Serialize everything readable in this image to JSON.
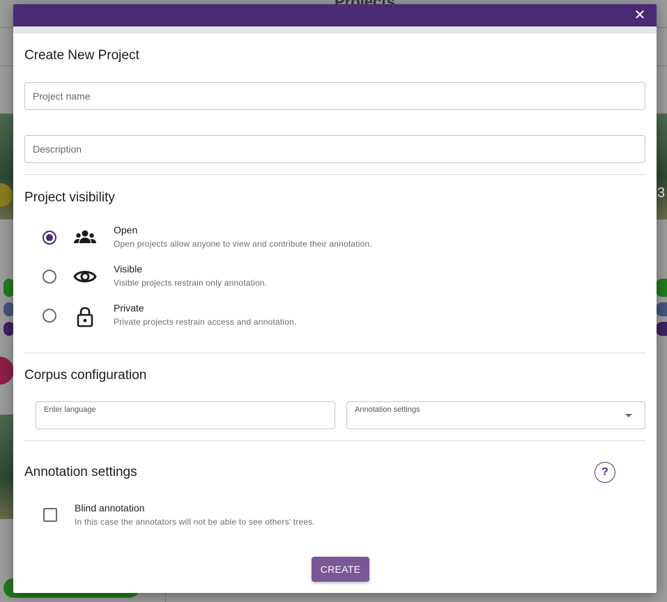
{
  "background": {
    "page_title": "Projects",
    "card_number": "3"
  },
  "dialog": {
    "close_icon": "close-icon",
    "title": "Create New Project",
    "project_name": {
      "value": "",
      "placeholder": "Project name"
    },
    "description": {
      "value": "",
      "placeholder": "Description"
    },
    "visibility": {
      "title": "Project visibility",
      "selected": "Open",
      "options": [
        {
          "label": "Open",
          "description": "Open projects allow anyone to view and contribute their annotation.",
          "icon": "group-icon",
          "checked": true
        },
        {
          "label": "Visible",
          "description": "Visible projects restrain only annotation.",
          "icon": "eye-icon",
          "checked": false
        },
        {
          "label": "Private",
          "description": "Private projects restrain access and annotation.",
          "icon": "lock-icon",
          "checked": false
        }
      ]
    },
    "corpus": {
      "title": "Corpus configuration",
      "language_label": "Enter language",
      "language_value": "",
      "annotation_settings_label": "Annotation settings",
      "annotation_settings_value": ""
    },
    "annotation": {
      "title": "Annotation settings",
      "help_label": "?",
      "blind_label": "Blind annotation",
      "blind_description": "In this case the annotators will not be able to see others' trees.",
      "blind_checked": false
    },
    "create_label": "CREATE"
  },
  "colors": {
    "primary": "#4a2a74",
    "button": "#7a5896"
  }
}
